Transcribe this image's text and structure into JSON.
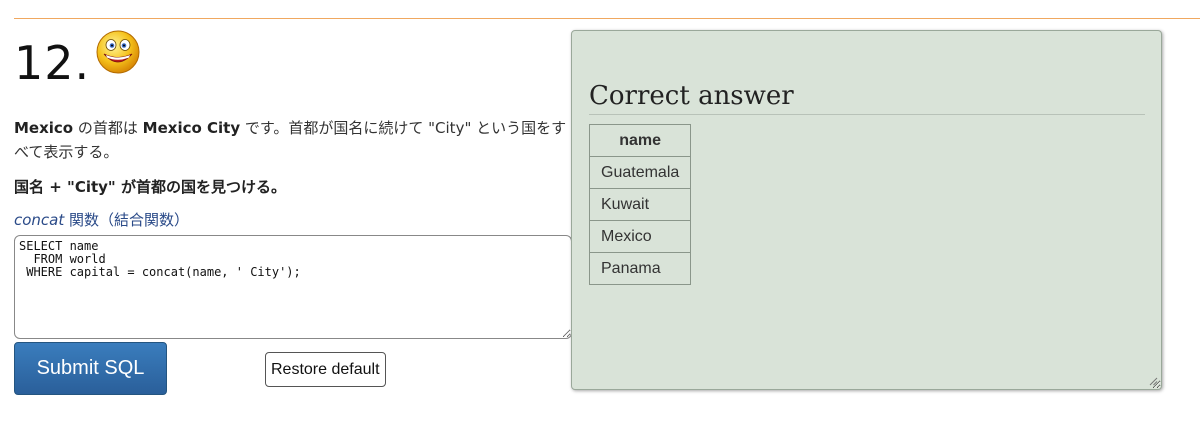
{
  "question": {
    "number": "12.",
    "smiley_icon": "smiley-face-icon",
    "description_parts": [
      {
        "text": "Mexico",
        "bold": true
      },
      {
        "text": " の首都は ",
        "bold": false
      },
      {
        "text": "Mexico City",
        "bold": true
      },
      {
        "text": " です。首都が国名に続けて \"City\" という国をすべて表示する。",
        "bold": false
      }
    ],
    "task": "国名 + \"City\" が首都の国を見つける。",
    "hint_function": "concat",
    "hint_text": " 関数（結合関数）"
  },
  "editor": {
    "sql": "SELECT name\n  FROM world\n WHERE capital = concat(name, ' City');"
  },
  "buttons": {
    "submit_label": "Submit SQL",
    "restore_label": "Restore default"
  },
  "answer": {
    "title": "Correct answer",
    "columns": [
      "name"
    ],
    "rows": [
      "Guatemala",
      "Kuwait",
      "Mexico",
      "Panama"
    ]
  },
  "colors": {
    "accent_rule": "#f0a860",
    "answer_background": "#d9e3d8",
    "submit_button": "#2f6fab"
  }
}
